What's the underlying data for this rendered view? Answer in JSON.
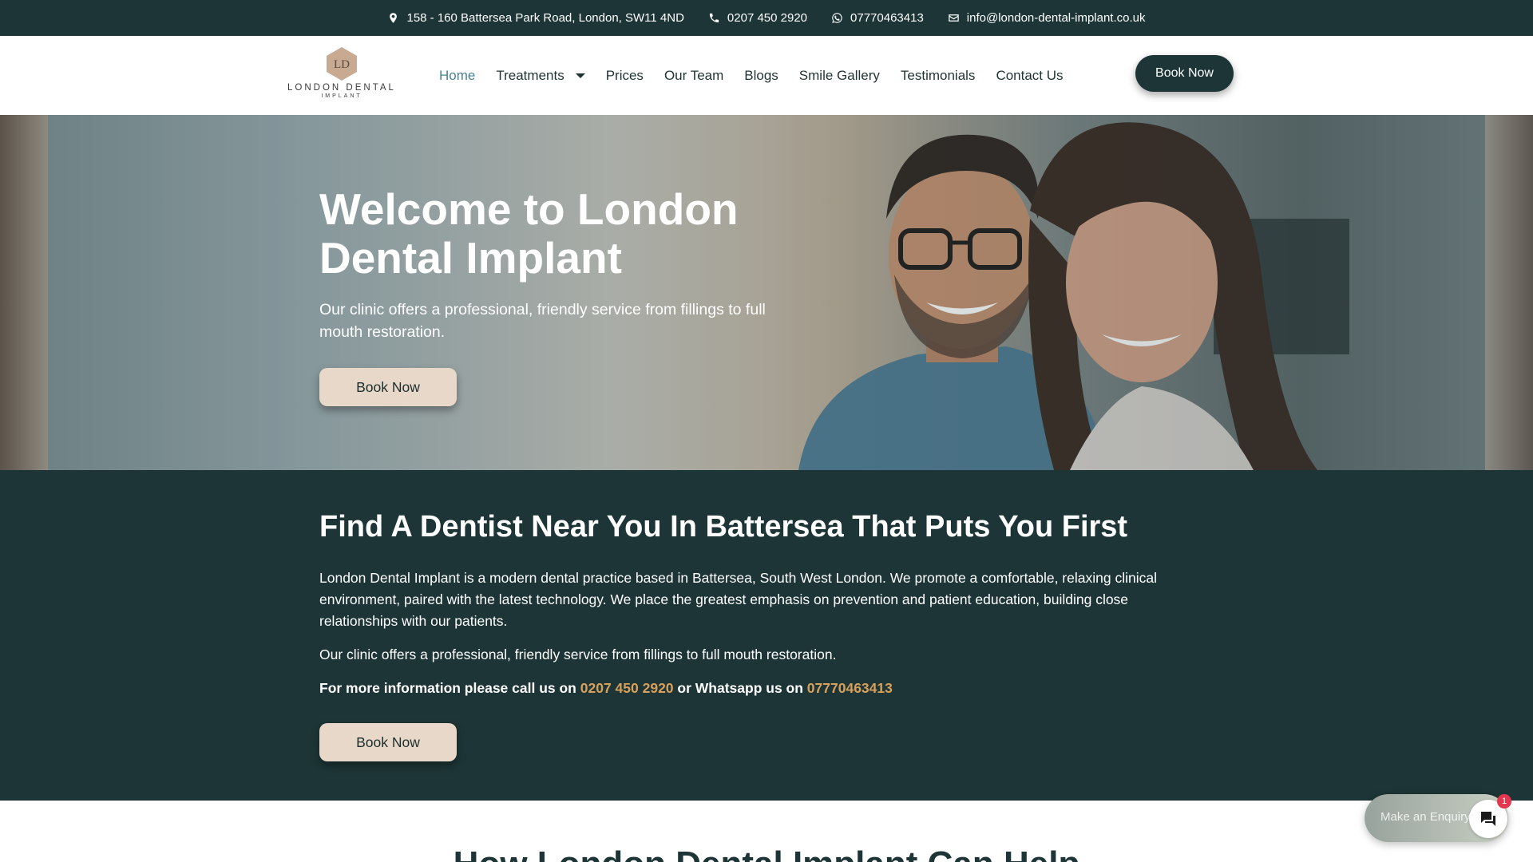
{
  "topbar": {
    "address": "158 - 160 Battersea Park Road, London, SW11 4ND",
    "phone": "0207 450 2920",
    "whatsapp": "07770463413",
    "email": "info@london-dental-implant.co.uk"
  },
  "logo": {
    "monogram": "LD",
    "name": "LONDON DENTAL",
    "sub": "IMPLANT"
  },
  "nav": {
    "items": [
      {
        "label": "Home",
        "active": true
      },
      {
        "label": "Treatments"
      },
      {
        "label": "Prices"
      },
      {
        "label": "Our Team"
      },
      {
        "label": "Blogs"
      },
      {
        "label": "Smile Gallery"
      },
      {
        "label": "Testimonials"
      },
      {
        "label": "Contact Us"
      }
    ],
    "book_label": "Book Now"
  },
  "hero": {
    "title": "Welcome to London Dental Implant",
    "subtitle": "Our clinic offers a professional, friendly service from fillings to full mouth restoration.",
    "button": "Book Now"
  },
  "intro": {
    "heading": "Find A Dentist Near You In Battersea That Puts You First",
    "para1": "London Dental Implant is a modern dental practice based in Battersea, South West London. We promote a comfortable, relaxing clinical environment, paired with the latest technology. We place the greatest emphasis on prevention and patient education, building close relationships with our patients.",
    "para2": "Our clinic offers a professional, friendly service from fillings to full mouth restoration.",
    "call_prefix": "For more information please call us on",
    "call_phone": "0207 450 2920",
    "call_mid": "or Whatsapp us on",
    "call_whatsapp": "07770463413",
    "button": "Book Now"
  },
  "next_section": {
    "title": "How London Dental Implant Can Help"
  },
  "chat": {
    "label": "Make an Enquiry",
    "badge": "1"
  },
  "colors": {
    "dark_green": "#1d3536",
    "accent_gold": "#d7a15c",
    "button_beige": "#e8d8c9",
    "active_nav": "#4a8192"
  }
}
